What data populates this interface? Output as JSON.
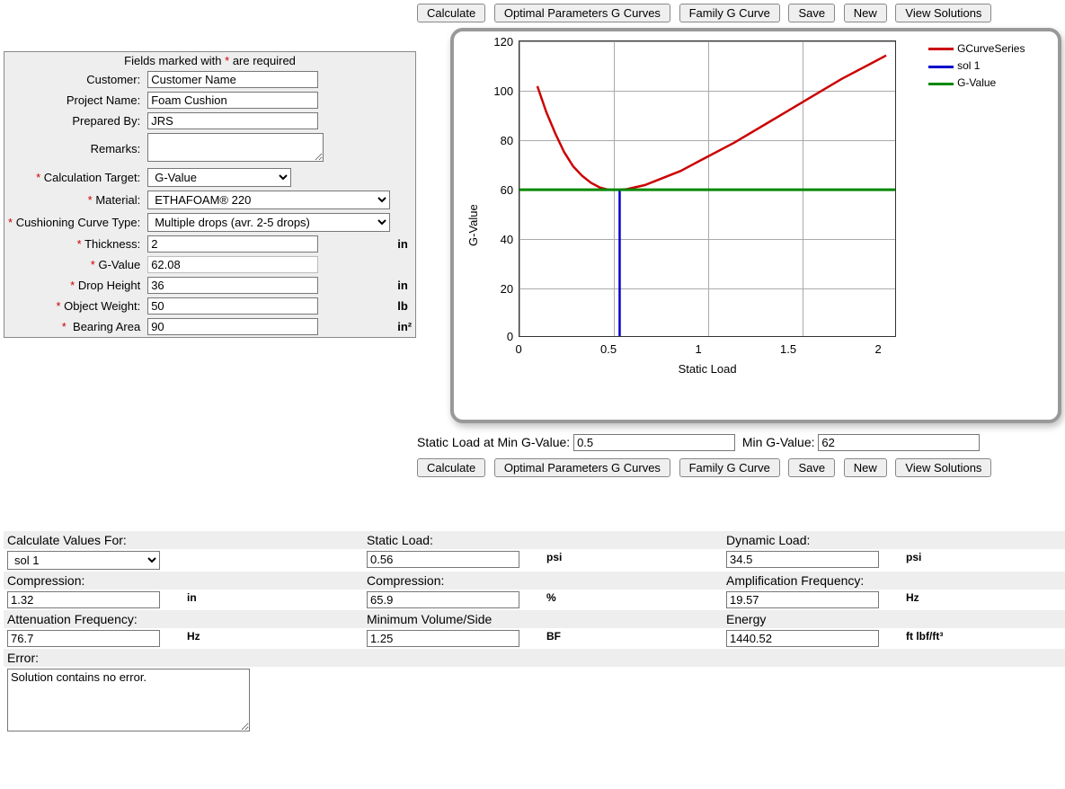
{
  "toolbar": {
    "calculate": "Calculate",
    "optimal": "Optimal Parameters G Curves",
    "family": "Family G Curve",
    "save": "Save",
    "new": "New",
    "view": "View Solutions"
  },
  "form": {
    "header_pre": "Fields marked with ",
    "header_post": " are required",
    "customer_label": "Customer:",
    "customer": "Customer Name",
    "project_label": "Project Name:",
    "project": "Foam Cushion",
    "prepared_label": "Prepared By:",
    "prepared": "JRS",
    "remarks_label": "Remarks:",
    "remarks": "",
    "calc_target_label": "Calculation Target:",
    "calc_target": "G-Value",
    "material_label": "Material:",
    "material": "ETHAFOAM® 220",
    "curve_type_label": "Cushioning Curve Type:",
    "curve_type": "Multiple drops (avr. 2-5 drops)",
    "thickness_label": "Thickness:",
    "thickness": "2",
    "thickness_unit": "in",
    "gvalue_label": "G-Value",
    "gvalue": "62.08",
    "drop_label": "Drop Height",
    "drop": "36",
    "drop_unit": "in",
    "weight_label": "Object Weight:",
    "weight": "50",
    "weight_unit": "lb",
    "bearing_label": "Bearing Area",
    "bearing": "90",
    "bearing_unit": "in²"
  },
  "mid": {
    "static_label": "Static Load at Min G-Value:",
    "static": "0.5",
    "min_g_label": "Min G-Value:",
    "min_g": "62"
  },
  "legend": {
    "a": "GCurveSeries",
    "b": "sol 1",
    "c": "G-Value"
  },
  "axes": {
    "y": "G-Value",
    "x": "Static Load"
  },
  "results": {
    "calc_for_label": "Calculate Values For:",
    "calc_for": "sol 1",
    "static_load_label": "Static Load:",
    "static_load": "0.56",
    "static_load_unit": "psi",
    "dynamic_label": "Dynamic Load:",
    "dynamic": "34.5",
    "dynamic_unit": "psi",
    "comp_in_label": "Compression:",
    "comp_in": "1.32",
    "comp_in_unit": "in",
    "comp_pct_label": "Compression:",
    "comp_pct": "65.9",
    "comp_pct_unit": "%",
    "amp_label": "Amplification Frequency:",
    "amp": "19.57",
    "amp_unit": "Hz",
    "atten_label": "Attenuation Frequency:",
    "atten": "76.7",
    "atten_unit": "Hz",
    "vol_label": "Minimum Volume/Side",
    "vol": "1.25",
    "vol_unit": "BF",
    "energy_label": "Energy",
    "energy": "1440.52",
    "energy_unit": "ft lbf/ft³",
    "error_label": "Error:",
    "error": "Solution contains no error."
  },
  "chart_data": {
    "type": "line",
    "xlabel": "Static Load",
    "ylabel": "G-Value",
    "xlim": [
      0,
      2.1
    ],
    "ylim": [
      0,
      125
    ],
    "series": [
      {
        "name": "GCurveSeries",
        "color": "#cc0000",
        "x": [
          0.1,
          0.15,
          0.2,
          0.25,
          0.3,
          0.35,
          0.4,
          0.45,
          0.5,
          0.56,
          0.6,
          0.7,
          0.8,
          0.9,
          1.0,
          1.2,
          1.4,
          1.6,
          1.8,
          2.0,
          2.05
        ],
        "values": [
          106,
          95,
          86,
          78,
          72,
          68,
          65,
          63,
          62,
          62.08,
          62.3,
          64,
          67,
          70,
          74,
          82,
          91,
          100,
          109,
          117,
          119
        ]
      },
      {
        "name": "sol 1",
        "color": "#0000cc",
        "x": [
          0.56,
          0.56
        ],
        "values": [
          0,
          62
        ]
      },
      {
        "name": "G-Value",
        "color": "#008800",
        "x": [
          0.0,
          2.1
        ],
        "values": [
          62.08,
          62.08
        ]
      }
    ],
    "x_ticks": [
      0,
      0.5,
      1,
      1.5,
      2
    ],
    "y_ticks": [
      0,
      20,
      40,
      60,
      80,
      100,
      120
    ]
  }
}
